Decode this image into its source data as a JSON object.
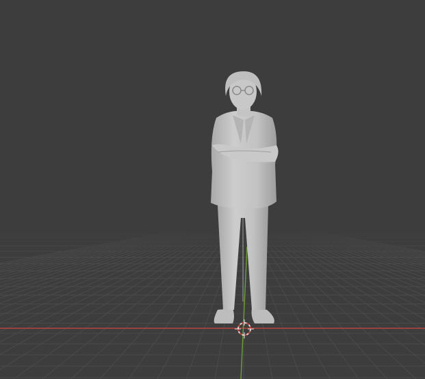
{
  "app": {
    "name": "3D viewport",
    "view": "perspective"
  },
  "scene": {
    "object": "standing-man-sculpt",
    "object_color": "#c6c6c6",
    "background_color": "#3d3d3d",
    "grid_color": "#4c4c4c",
    "x_axis_color": "#c8443f",
    "y_axis_color": "#6aa032",
    "cursor_icon": "3d-cursor-icon"
  }
}
